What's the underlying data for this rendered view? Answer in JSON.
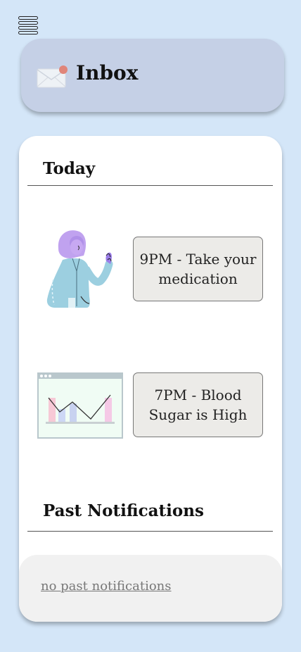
{
  "header": {
    "title": "Inbox",
    "icon": "envelope-notification-icon"
  },
  "menu": {
    "icon": "hamburger-menu-icon"
  },
  "today": {
    "title": "Today",
    "notifications": [
      {
        "text": "9PM - Take your medication",
        "illustration": "woman-waving-illustration"
      },
      {
        "text": "7PM - Blood Sugar is High",
        "illustration": "blood-sugar-chart-illustration"
      }
    ]
  },
  "past": {
    "title": "Past Notifications",
    "empty_text": "no past notifications"
  },
  "colors": {
    "background": "#d4e6f8",
    "header_card": "#c5d0e6",
    "card": "#ffffff",
    "notification_box": "#ecebe8",
    "past_panel": "#f1f1f1",
    "notification_dot": "#e0857a"
  }
}
